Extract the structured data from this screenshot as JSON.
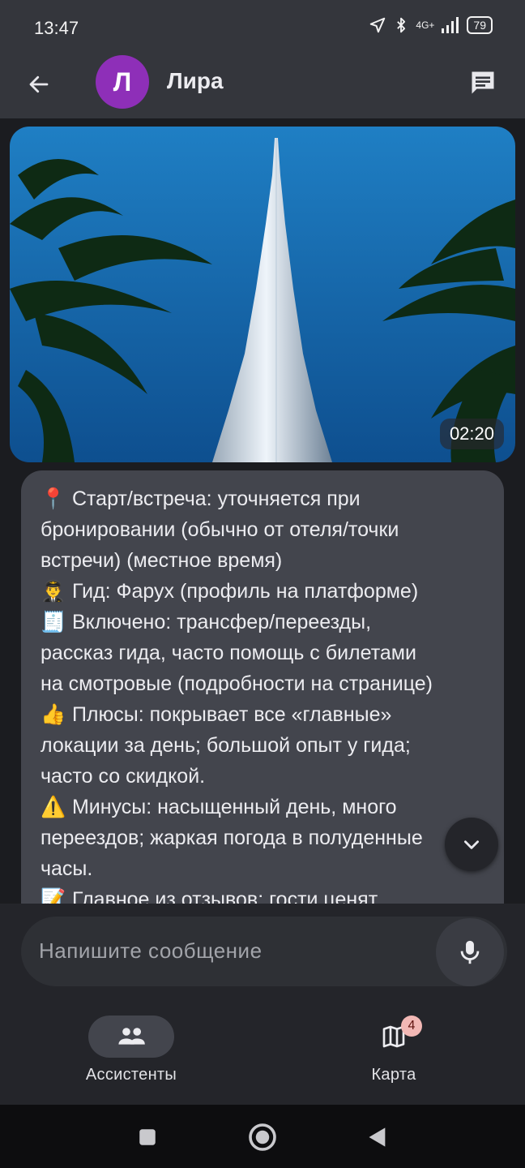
{
  "status_bar": {
    "time": "13:47",
    "network": "4G+",
    "battery": "79"
  },
  "app_bar": {
    "avatar_letter": "Л",
    "chat_name": "Лира",
    "avatar_color": "#8e2fb8"
  },
  "media": {
    "duration": "02:20"
  },
  "message": {
    "lines": [
      {
        "emoji": "📍",
        "text": "Старт/встреча: уточняется при"
      },
      {
        "emoji": "",
        "text": "бронировании (обычно от отеля/точки"
      },
      {
        "emoji": "",
        "text": "встречи) (местное время)"
      },
      {
        "emoji": "👨‍✈️",
        "text": "Гид: Фарух (профиль на платформе)"
      },
      {
        "emoji": "🧾",
        "text": "Включено: трансфер/переезды,"
      },
      {
        "emoji": "",
        "text": "рассказ гида, часто помощь с билетами"
      },
      {
        "emoji": "",
        "text": "на смотровые (подробности на странице)"
      },
      {
        "emoji": "👍",
        "text": "Плюсы: покрывает все «главные»"
      },
      {
        "emoji": "",
        "text": "локации за день; большой опыт у гида;"
      },
      {
        "emoji": "",
        "text": "часто со скидкой."
      },
      {
        "emoji": "⚠️",
        "text": "Минусы: насыщенный день, много"
      },
      {
        "emoji": "",
        "text": "переездов; жаркая погода в полуденные"
      },
      {
        "emoji": "",
        "text": "часы."
      },
      {
        "emoji": "📝",
        "text": "Главное из отзывов: гости ценят"
      }
    ]
  },
  "composer": {
    "placeholder": "Напишите сообщение"
  },
  "bottom_nav": {
    "items": [
      {
        "label": "Ассистенты",
        "icon": "people-icon",
        "active": true
      },
      {
        "label": "Карта",
        "icon": "map-icon",
        "badge": "4"
      }
    ]
  },
  "colors": {
    "background": "#1b1c20",
    "bubble": "#43454d",
    "bar": "#34363c",
    "badge": "#f2b8b5"
  }
}
